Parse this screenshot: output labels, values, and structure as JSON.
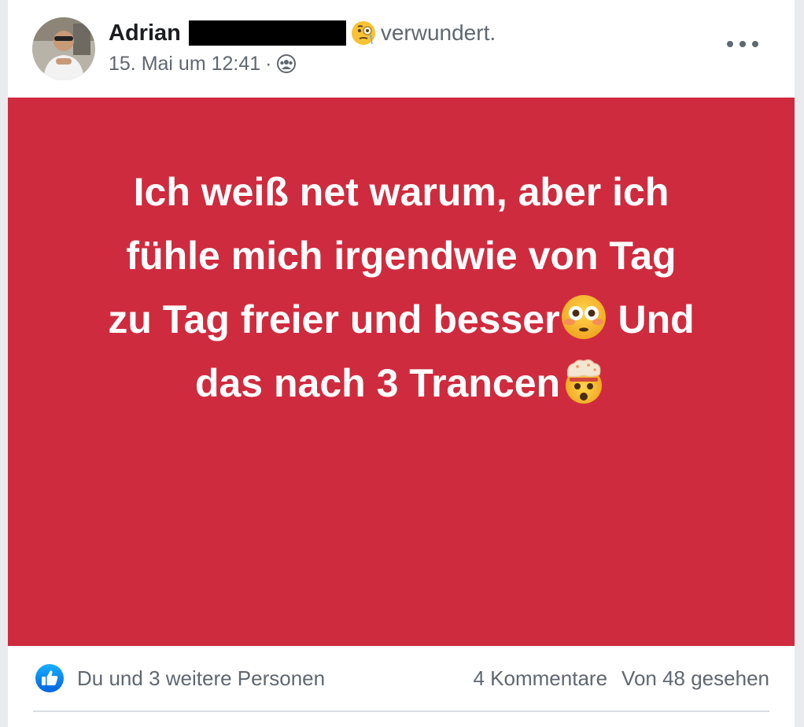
{
  "post": {
    "author": {
      "name": "Adrian",
      "name_redacted": true,
      "avatar_icon": "profile-photo"
    },
    "feeling": {
      "emoji_icon": "face-with-monocle-emoji",
      "text": "verwundert."
    },
    "meta": {
      "date": "15. Mai um 12:41",
      "separator": "·",
      "audience_icon": "friends-audience-icon"
    },
    "more_icon": "more-options-icon",
    "background_color": "#cf2b3e",
    "text_lines": [
      {
        "text": "Ich weiß net warum, aber ich"
      },
      {
        "text": "fühle mich irgendwie von Tag"
      },
      {
        "before": "zu Tag freier und besser",
        "emoji_icon": "flushed-face-emoji",
        "after": " Und"
      },
      {
        "before": "das nach 3 Trancen",
        "emoji_icon": "exploding-head-emoji"
      }
    ]
  },
  "footer": {
    "reaction_icon": "like-reaction-icon",
    "reactions_text": "Du und 3 weitere Personen",
    "comments": "4 Kommentare",
    "seen": "Von 48 gesehen"
  }
}
